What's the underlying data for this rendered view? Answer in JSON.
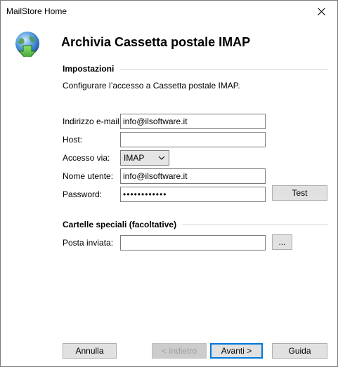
{
  "window": {
    "title": "MailStore Home",
    "close_icon": "close-icon"
  },
  "header": {
    "title": "Archivia Cassetta postale IMAP",
    "logo_icon": "globe-download-icon"
  },
  "settings": {
    "section_title": "Impostazioni",
    "description": "Configurare l’accesso a Cassetta postale IMAP.",
    "email": {
      "label": "Indirizzo e-mail:",
      "value": "info@ilsoftware.it"
    },
    "host": {
      "label": "Host:",
      "value": ""
    },
    "access": {
      "label": "Accesso via:",
      "value": "IMAP"
    },
    "username": {
      "label": "Nome utente:",
      "value": "info@ilsoftware.it"
    },
    "password": {
      "label": "Password:",
      "value": "••••••••••••"
    },
    "test_label": "Test"
  },
  "special_folders": {
    "section_title": "Cartelle speciali (facoltative)",
    "sent": {
      "label": "Posta inviata:",
      "value": ""
    },
    "browse_label": "..."
  },
  "footer": {
    "cancel_label": "Annulla",
    "back_label": "< Indietro",
    "next_label": "Avanti >",
    "help_label": "Guida"
  },
  "colors": {
    "accent": "#0078d7",
    "window_bg": "#ffffff",
    "button_bg": "#e1e1e1"
  }
}
